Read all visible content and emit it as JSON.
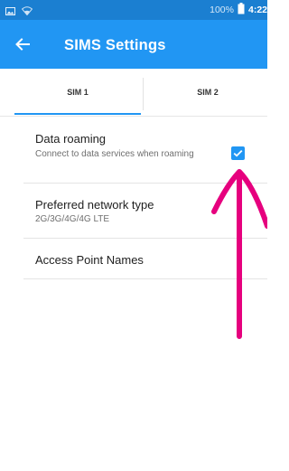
{
  "status_bar": {
    "battery": "100%",
    "time": "4:22",
    "icons": [
      "image-icon",
      "wifi-icon",
      "battery-icon"
    ]
  },
  "app_bar": {
    "title": "SIMS Settings",
    "back_icon": "arrow-back-icon"
  },
  "tabs": [
    {
      "label": "SIM 1",
      "selected": true
    },
    {
      "label": "SIM 2",
      "selected": false
    }
  ],
  "settings": [
    {
      "title": "Data roaming",
      "summary": "Connect to data services when roaming",
      "checked": true
    },
    {
      "title": "Preferred network type",
      "summary": "2G/3G/4G/4G LTE"
    },
    {
      "title": "Access Point Names",
      "summary": ""
    }
  ],
  "colors": {
    "status_bar": "#1b7fd1",
    "app_bar": "#2196f3",
    "accent": "#2196f3",
    "annotation_arrow": "#e6007e"
  },
  "annotation": {
    "icon": "arrow-up-icon"
  }
}
